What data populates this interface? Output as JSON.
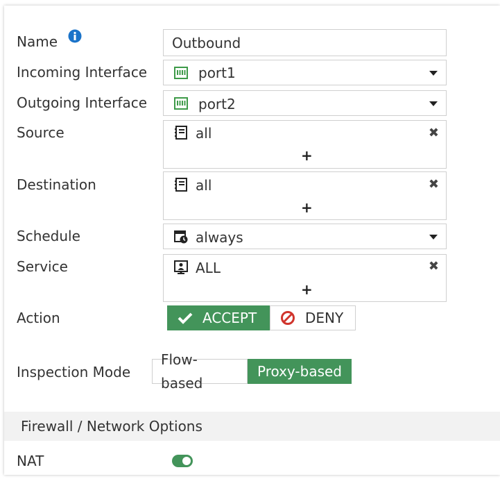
{
  "form": {
    "name": {
      "label": "Name",
      "value": "Outbound"
    },
    "incoming": {
      "label": "Incoming Interface",
      "value": "port1",
      "icon": "port-icon"
    },
    "outgoing": {
      "label": "Outgoing Interface",
      "value": "port2",
      "icon": "port-icon"
    },
    "source": {
      "label": "Source",
      "value": "all",
      "icon": "address-icon",
      "add": "+",
      "remove": "✖"
    },
    "destination": {
      "label": "Destination",
      "value": "all",
      "icon": "address-icon",
      "add": "+",
      "remove": "✖"
    },
    "schedule": {
      "label": "Schedule",
      "value": "always",
      "icon": "schedule-icon"
    },
    "service": {
      "label": "Service",
      "value": "ALL",
      "icon": "service-icon",
      "add": "+",
      "remove": "✖"
    },
    "action": {
      "label": "Action",
      "accept": "ACCEPT",
      "deny": "DENY",
      "selected": "accept"
    },
    "inspection": {
      "label": "Inspection Mode",
      "flow": "Flow-based",
      "proxy": "Proxy-based",
      "selected": "proxy"
    }
  },
  "section": {
    "title": "Firewall / Network Options"
  },
  "nat": {
    "label": "NAT",
    "enabled": true
  },
  "colors": {
    "accent": "#43945a",
    "info": "#1a73c9",
    "deny": "#d0342c"
  }
}
